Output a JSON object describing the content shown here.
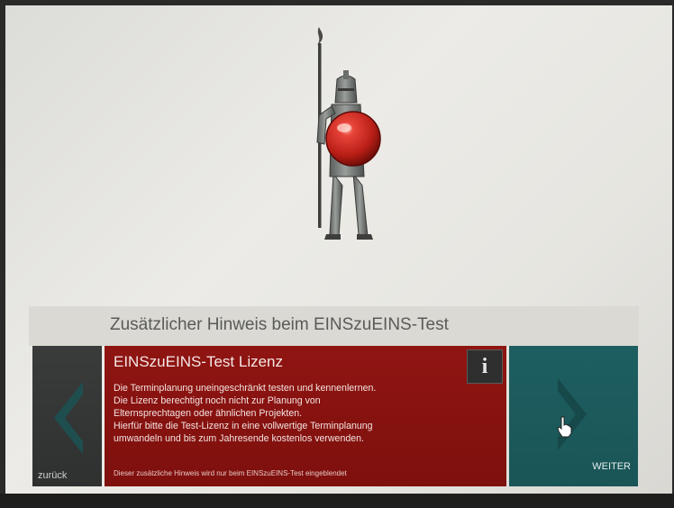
{
  "header": {
    "title": "Zusätzlicher Hinweis beim EINSzuEINS-Test"
  },
  "back_tile": {
    "label": "zurück",
    "icon": "chevron-left-icon"
  },
  "info_tile": {
    "heading": "EINSzuEINS-Test Lizenz",
    "info_icon_glyph": "i",
    "lines": [
      "Die Terminplanung uneingeschränkt testen und kennenlernen.",
      "Die Lizenz berechtigt noch nicht zur Planung von",
      "Elternsprechtagen oder ähnlichen Projekten.",
      "Hierfür bitte die Test-Lizenz in eine vollwertige Terminplanung",
      "umwandeln und bis zum Jahresende kostenlos verwenden."
    ],
    "footnote": "Dieser zusätzliche Hinweis wird nur beim EINSzuEINS-Test eingeblendet"
  },
  "next_tile": {
    "label": "WEITER",
    "icon": "chevron-right-icon"
  },
  "logo": {
    "icon": "knight-with-spear-and-red-shield-logo"
  },
  "colors": {
    "info_tile": "#8a1411",
    "next_tile": "#1c5b5d",
    "back_tile": "#363837",
    "header_bar": "#dad9d4",
    "shield": "#c8281e"
  }
}
